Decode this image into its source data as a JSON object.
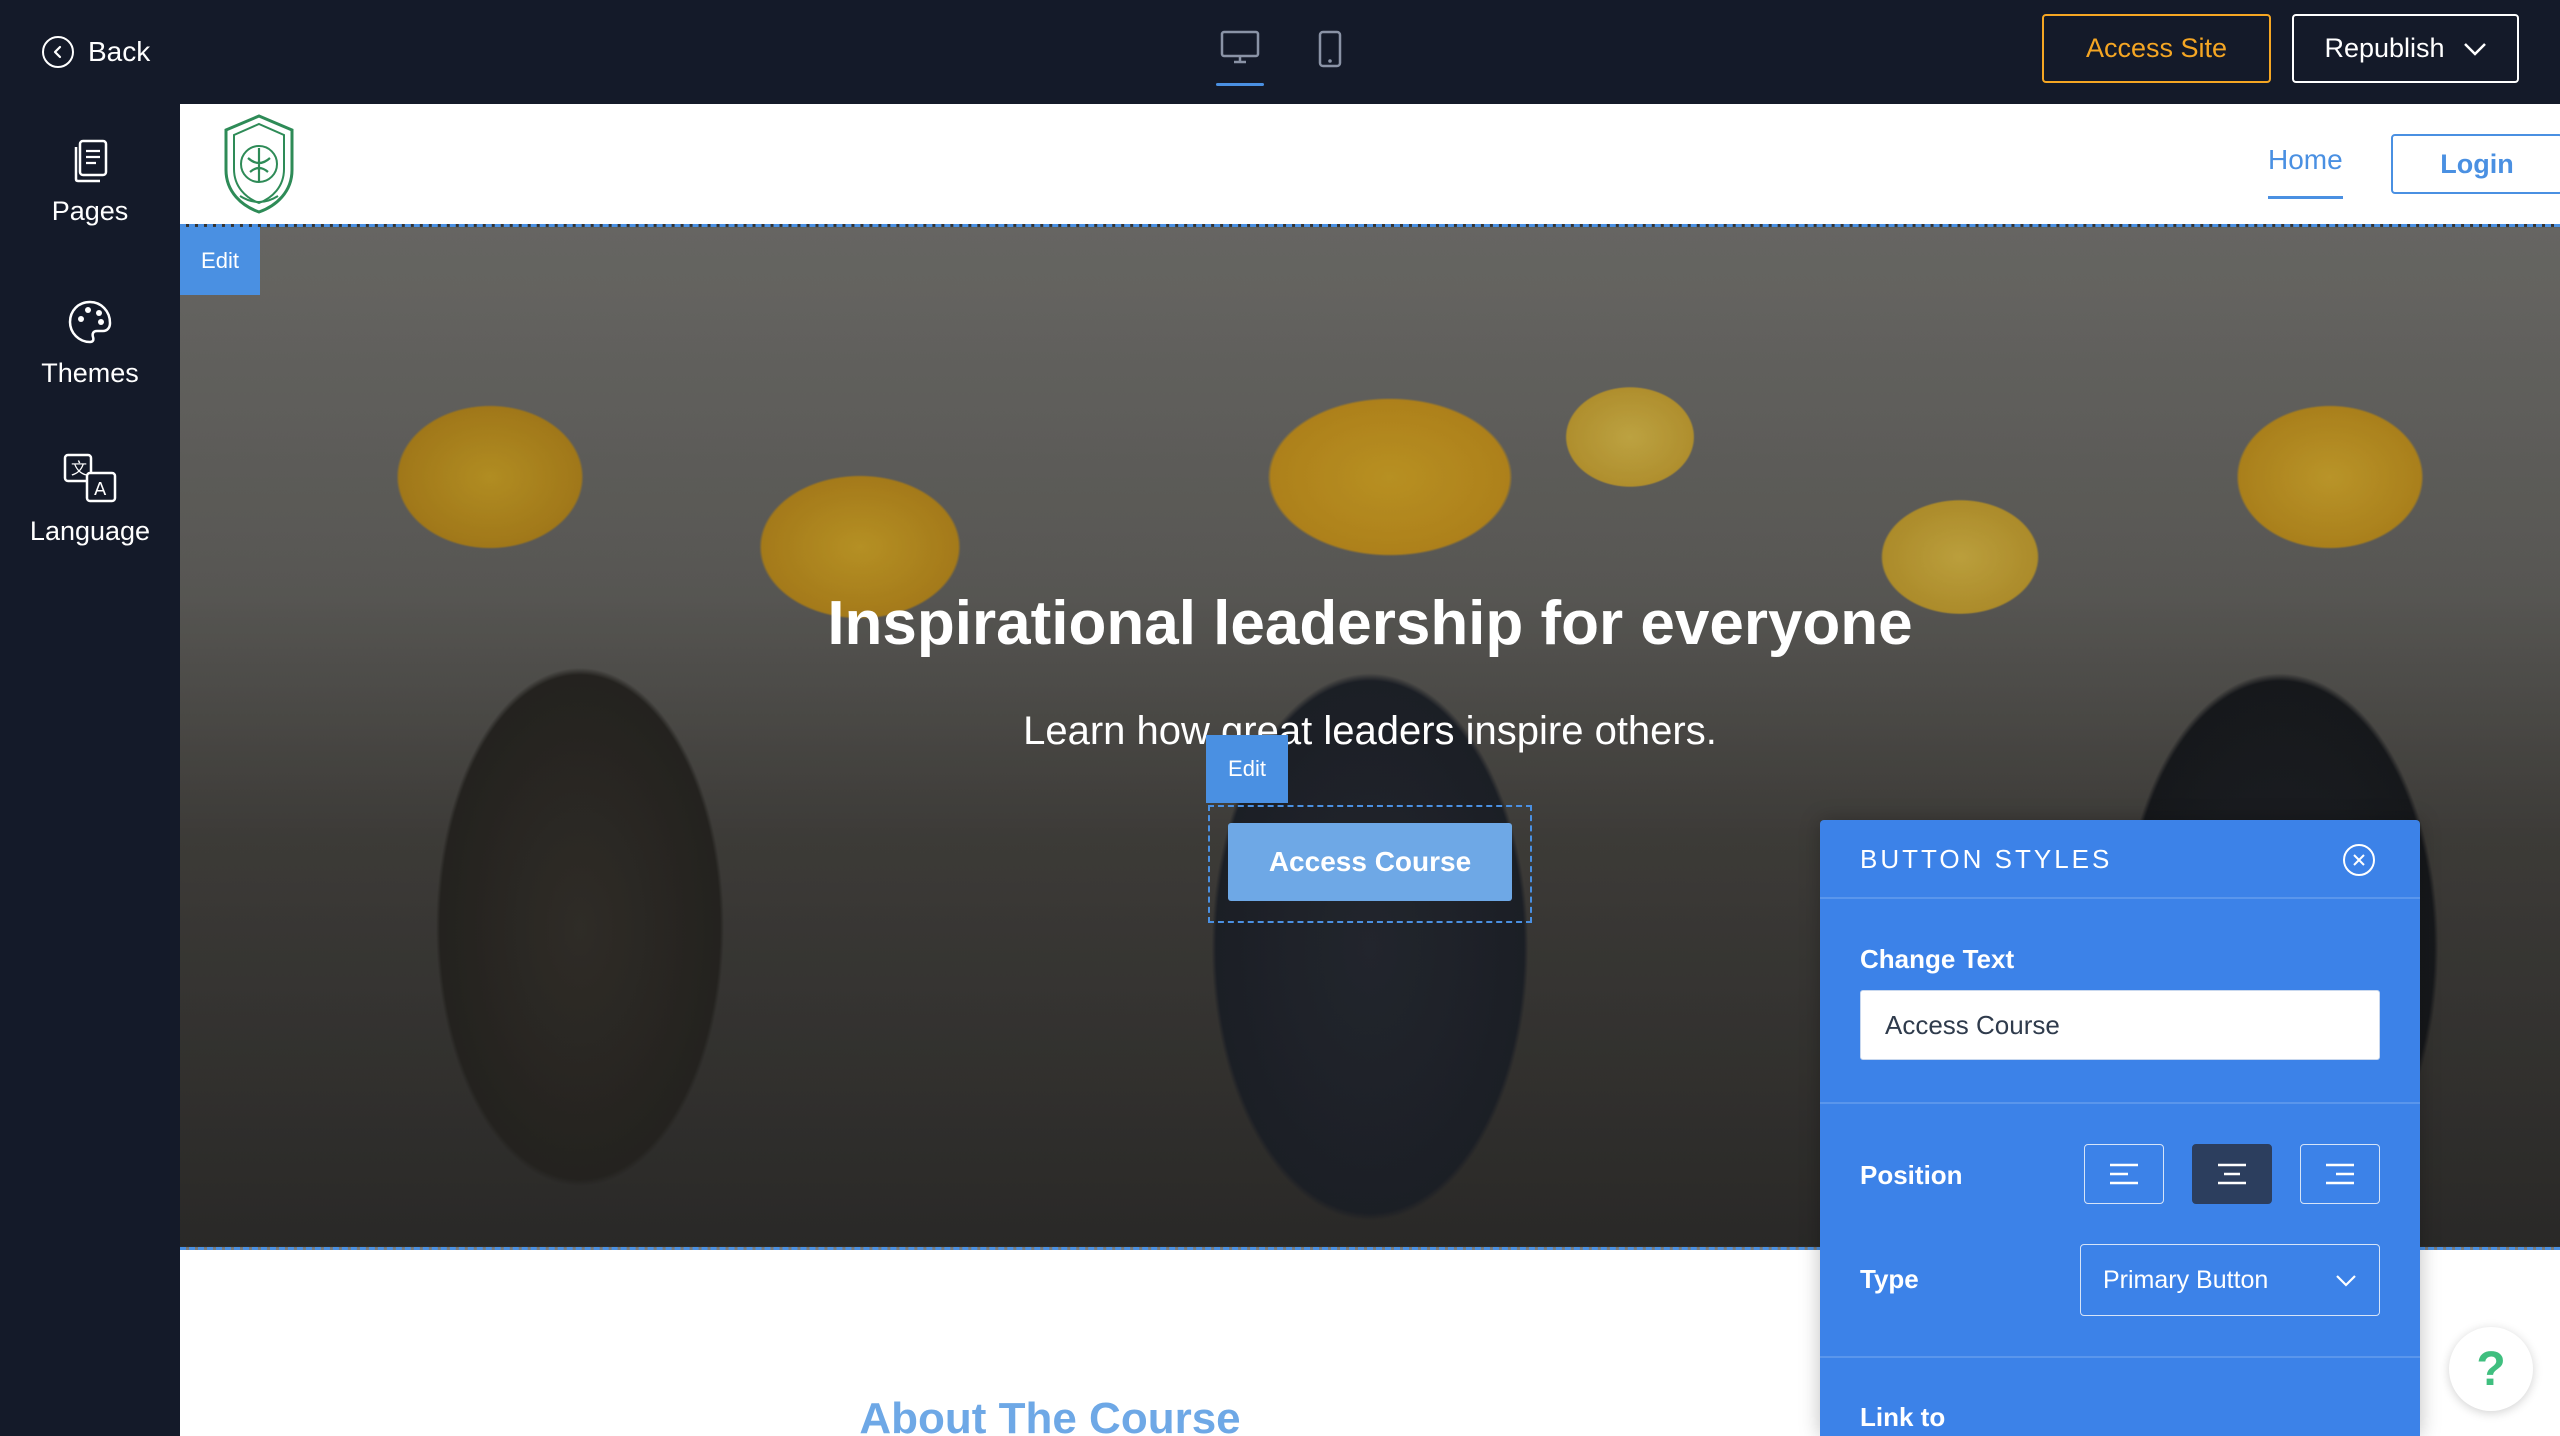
{
  "topbar": {
    "back_label": "Back",
    "access_site_label": "Access Site",
    "republish_label": "Republish"
  },
  "sidebar": {
    "items": [
      {
        "label": "Pages",
        "icon": "pages-icon"
      },
      {
        "label": "Themes",
        "icon": "palette-icon"
      },
      {
        "label": "Language",
        "icon": "translate-icon"
      }
    ]
  },
  "site": {
    "nav": {
      "home_label": "Home",
      "login_label": "Login"
    },
    "hero": {
      "edit_label": "Edit",
      "title": "Inspirational leadership for everyone",
      "subtitle": "Learn how great leaders inspire others.",
      "button_edit_label": "Edit",
      "button_label": "Access Course"
    },
    "about_title": "About The Course"
  },
  "panel": {
    "title": "BUTTON STYLES",
    "change_text_label": "Change Text",
    "change_text_value": "Access Course",
    "position_label": "Position",
    "position_selected": "center",
    "type_label": "Type",
    "type_value": "Primary Button",
    "link_label": "Link to"
  },
  "help_label": "?",
  "colors": {
    "topbar_bg": "#141a29",
    "accent": "#4a90e2",
    "access_site": "#f5a623",
    "panel_bg": "#3c82e8",
    "help": "#3fbf7f"
  }
}
